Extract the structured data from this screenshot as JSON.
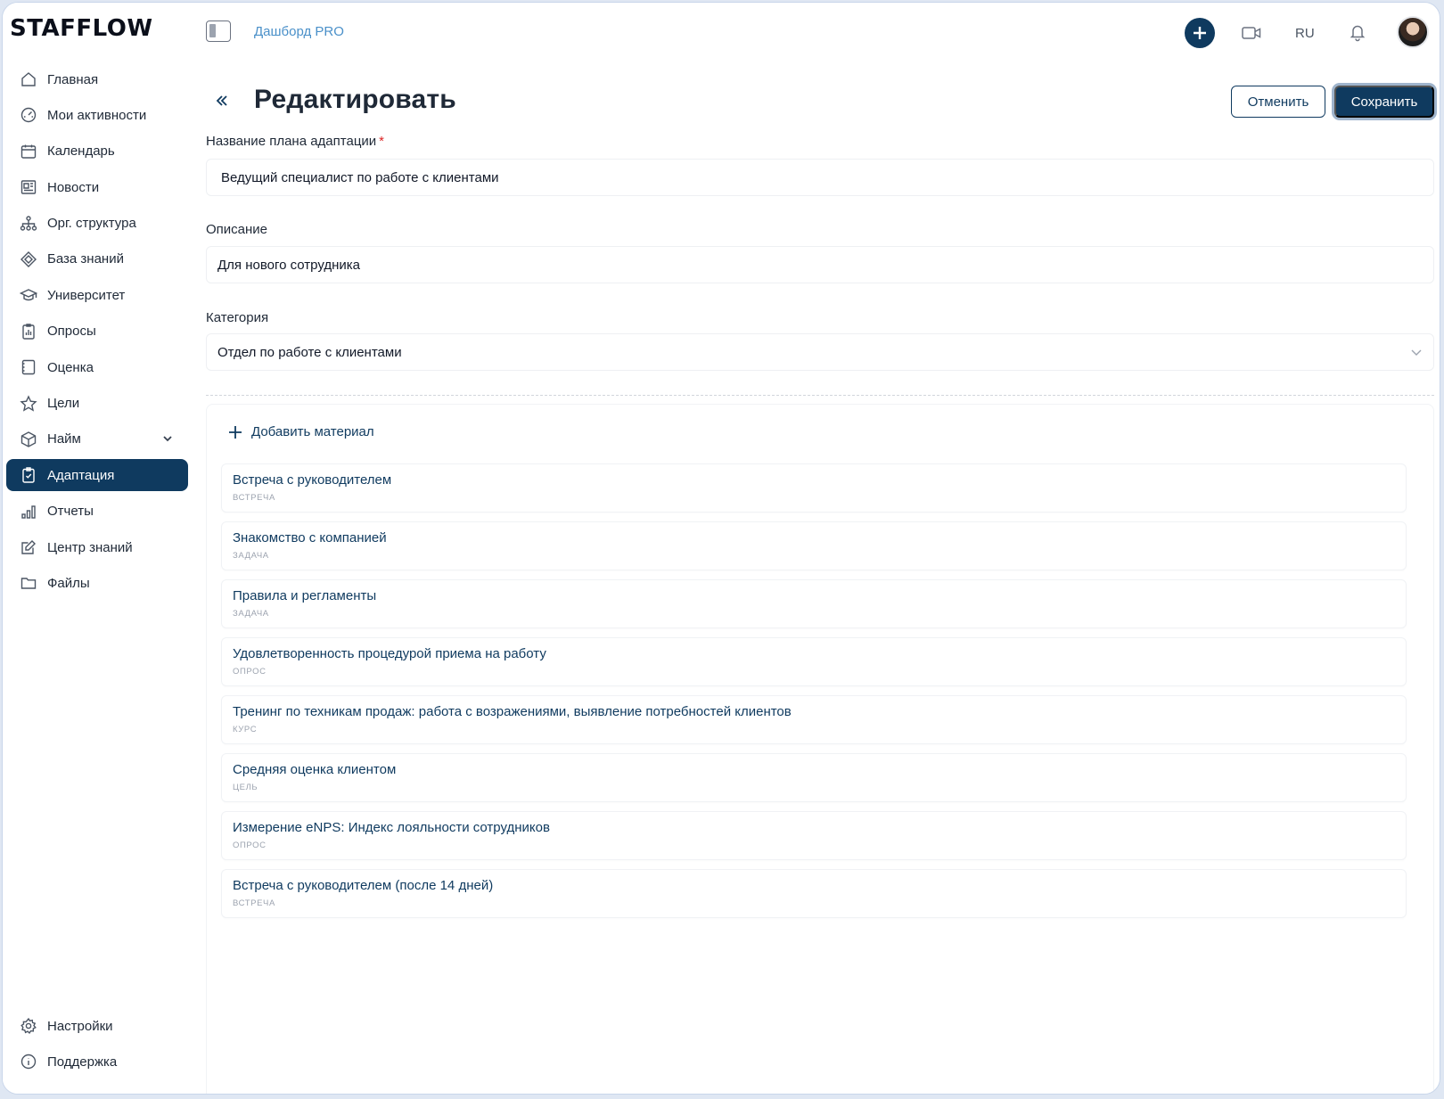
{
  "app": {
    "logo": "STAFFLOW",
    "breadcrumb": "Дашборд PRO",
    "language": "RU"
  },
  "icons": {
    "primary_color": "#0f3a5f",
    "accent_link": "#4a90c9"
  },
  "sidebar": {
    "items": [
      {
        "label": "Главная",
        "icon": "home-icon"
      },
      {
        "label": "Мои активности",
        "icon": "gauge-icon"
      },
      {
        "label": "Календарь",
        "icon": "calendar-icon"
      },
      {
        "label": "Новости",
        "icon": "news-icon"
      },
      {
        "label": "Орг. структура",
        "icon": "org-structure-icon"
      },
      {
        "label": "База знаний",
        "icon": "knowledge-base-icon"
      },
      {
        "label": "Университет",
        "icon": "graduation-cap-icon"
      },
      {
        "label": "Опросы",
        "icon": "survey-icon"
      },
      {
        "label": "Оценка",
        "icon": "assessment-icon"
      },
      {
        "label": "Цели",
        "icon": "star-icon"
      },
      {
        "label": "Найм",
        "icon": "box-icon"
      },
      {
        "label": "Адаптация",
        "icon": "clipboard-check-icon",
        "active": true
      },
      {
        "label": "Отчеты",
        "icon": "bar-chart-icon"
      },
      {
        "label": "Центр знаний",
        "icon": "edit-icon"
      },
      {
        "label": "Файлы",
        "icon": "folder-icon"
      }
    ],
    "bottom": [
      {
        "label": "Настройки",
        "icon": "gear-icon"
      },
      {
        "label": "Поддержка",
        "icon": "info-icon"
      }
    ]
  },
  "page": {
    "title": "Редактировать",
    "cancel_label": "Отменить",
    "save_label": "Сохранить"
  },
  "form": {
    "name_label": "Название плана адаптации",
    "name_required_mark": "*",
    "name_value": "Ведущий специалист по работе с клиентами",
    "description_label": "Описание",
    "description_value": "Для нового сотрудника",
    "category_label": "Категория",
    "category_value": "Отдел по работе с клиентами"
  },
  "materials": {
    "add_label": "Добавить материал",
    "items": [
      {
        "title": "Встреча с руководителем",
        "type": "ВСТРЕЧА"
      },
      {
        "title": "Знакомство с компанией",
        "type": "ЗАДАЧА"
      },
      {
        "title": "Правила и регламенты",
        "type": "ЗАДАЧА"
      },
      {
        "title": "Удовлетворенность процедурой приема на работу",
        "type": "ОПРОС"
      },
      {
        "title": "Тренинг по техникам продаж: работа с возражениями, выявление потребностей клиентов",
        "type": "КУРС"
      },
      {
        "title": "Средняя оценка клиентом",
        "type": "ЦЕЛЬ"
      },
      {
        "title": "Измерение eNPS: Индекс лояльности сотрудников",
        "type": "ОПРОС"
      },
      {
        "title": "Встреча с руководителем (после 14 дней)",
        "type": "ВСТРЕЧА"
      }
    ]
  }
}
